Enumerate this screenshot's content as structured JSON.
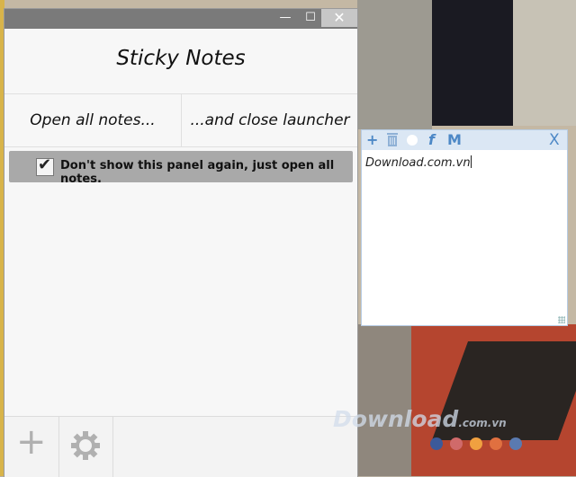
{
  "window": {
    "minimize_glyph": "—",
    "maximize_glyph": "☐",
    "close_glyph": "✕"
  },
  "app": {
    "title": "Sticky Notes",
    "open_all_label": "Open all notes...",
    "close_launcher_label": "...and close launcher",
    "dont_show_label": "Don't show this panel again, just open all notes.",
    "dont_show_checked": true
  },
  "bottom_bar": {
    "add_icon": "plus-icon",
    "settings_icon": "gear-icon"
  },
  "note": {
    "toolbar": {
      "add_glyph": "+",
      "bold_glyph": "f",
      "menu_glyph": "M",
      "close_glyph": "X"
    },
    "text": "Download.com.vn"
  },
  "watermark": {
    "brand": "Download",
    "suffix": ".com.vn",
    "dot_colors": [
      "#3c5a9a",
      "#d06a6a",
      "#f0a040",
      "#e07040",
      "#5a7ab0"
    ]
  }
}
